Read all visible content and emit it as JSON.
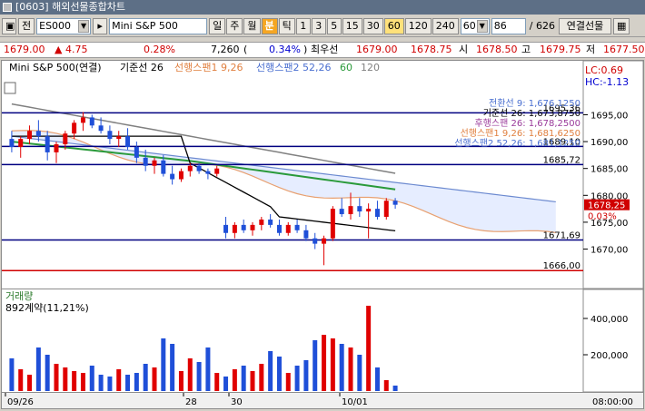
{
  "window": {
    "title": "[0603] 해외선물종합차트"
  },
  "toolbar": {
    "jeon_label": "전",
    "symbol": "ES000",
    "product_name": "Mini S&P 500",
    "period_buttons": [
      "일",
      "주",
      "월",
      "분",
      "틱",
      "1",
      "3",
      "5",
      "15",
      "30",
      "60",
      "120",
      "240"
    ],
    "active_period": "분",
    "selected_interval": "60",
    "interval_value": "60",
    "count_value": "86",
    "count_total": "/ 626",
    "link_button": "연결선물"
  },
  "quote": {
    "price": "1679.00",
    "change": "▲ 4.75",
    "change_pct": "0.28%",
    "volume": "7,260",
    "vol_open_paren": "(",
    "vol_pct": "0.34%",
    "vol_close_paren": ")",
    "best_label": "최우선",
    "bid": "1679.00",
    "ask": "1678.75",
    "open_label": "시",
    "open": "1678.50",
    "high_label": "고",
    "high": "1679.75",
    "low_label": "저",
    "low": "1677.50"
  },
  "chart": {
    "legend": {
      "title": "Mini S&P 500(연결)",
      "base_line": "기준선 26",
      "span1": "선행스팬1 9,26",
      "span2": "선행스팬2 52,26",
      "extra1": "60",
      "extra2": "120"
    },
    "corner": {
      "lc": "LC:0.69",
      "hc": "HC:-1.13"
    },
    "price_ticks": [
      "1695,00",
      "1690,00",
      "1685,00",
      "1680,00",
      "1675,00",
      "1670,00"
    ],
    "hlines": [
      {
        "label": "1695,36",
        "value": 1695.36,
        "color": "#000080"
      },
      {
        "label": "1689,10",
        "value": 1689.1,
        "color": "#000080"
      },
      {
        "label": "1685,72",
        "value": 1685.72,
        "color": "#000080"
      },
      {
        "label": "1671,69",
        "value": 1671.69,
        "color": "#000080"
      },
      {
        "label": "1666,00",
        "value": 1666.0,
        "color": "#d00000"
      }
    ],
    "overlay_labels": [
      {
        "text": "전환선 9: 1,676,1250",
        "color": "#4a6fd0"
      },
      {
        "text": "기준선 26: 1,673,8750",
        "color": "#000000"
      },
      {
        "text": "후행스팬 26: 1,678,2500",
        "color": "#9a3a9a"
      },
      {
        "text": "선행스팬1 9,26: 1,681,6250",
        "color": "#e08040"
      },
      {
        "text": "선행스팬2 52,26: 1,681,1250",
        "color": "#4a6fd0"
      }
    ],
    "current_price": "1678,25",
    "current_pct": "0,03%",
    "volume_title": "거래량",
    "volume_sub": "892계약(11,21%)",
    "volume_ticks": [
      "400,000",
      "200,000"
    ],
    "date_labels": [
      "09/26",
      "28",
      "30",
      "10/01"
    ],
    "time_label": "08:00:00"
  },
  "chart_data": {
    "type": "candlestick",
    "candles": [
      [
        1690.5,
        1692,
        1688,
        1689
      ],
      [
        1689,
        1691,
        1687,
        1690.5
      ],
      [
        1690.5,
        1693,
        1689.5,
        1692
      ],
      [
        1692,
        1694,
        1690,
        1691
      ],
      [
        1691,
        1692,
        1686.5,
        1688
      ],
      [
        1688,
        1690,
        1686,
        1689.5
      ],
      [
        1689.5,
        1692,
        1688.5,
        1691.5
      ],
      [
        1691.5,
        1694,
        1690.5,
        1693.5
      ],
      [
        1693.5,
        1695.5,
        1692,
        1694.5
      ],
      [
        1694.5,
        1695,
        1692.5,
        1693
      ],
      [
        1693,
        1694.5,
        1691.5,
        1692
      ],
      [
        1692,
        1693,
        1689.5,
        1690.5
      ],
      [
        1690.5,
        1692,
        1689,
        1691
      ],
      [
        1691,
        1692.5,
        1688.5,
        1689
      ],
      [
        1689,
        1690,
        1686,
        1687
      ],
      [
        1687,
        1688.5,
        1684.5,
        1685.5
      ],
      [
        1685.5,
        1687,
        1684,
        1686.5
      ],
      [
        1686.5,
        1687.5,
        1683.5,
        1684
      ],
      [
        1684,
        1685.5,
        1682,
        1683
      ],
      [
        1683,
        1685,
        1682.5,
        1684.5
      ],
      [
        1684.5,
        1686,
        1683.5,
        1685.5
      ],
      [
        1685.5,
        1686,
        1684,
        1684.5
      ],
      [
        1684.5,
        1685,
        1683,
        1684
      ],
      [
        1684,
        1685.5,
        1683.5,
        1685
      ],
      [
        1674.5,
        1676,
        1672,
        1673
      ],
      [
        1673,
        1675,
        1672,
        1674.5
      ],
      [
        1674.5,
        1675.5,
        1673,
        1673.5
      ],
      [
        1673.5,
        1675,
        1672.5,
        1674.5
      ],
      [
        1674.5,
        1676,
        1673.5,
        1675.5
      ],
      [
        1675.5,
        1676.5,
        1674,
        1674.5
      ],
      [
        1674.5,
        1675.5,
        1672.5,
        1673
      ],
      [
        1673,
        1675,
        1672.5,
        1674.5
      ],
      [
        1674.5,
        1675.5,
        1673,
        1673.5
      ],
      [
        1673.5,
        1674.5,
        1671.5,
        1672
      ],
      [
        1672,
        1673,
        1670,
        1671
      ],
      [
        1671,
        1672.5,
        1667,
        1672
      ],
      [
        1672,
        1678,
        1671.5,
        1677.5
      ],
      [
        1677.5,
        1679.5,
        1676,
        1676.5
      ],
      [
        1676.5,
        1680.5,
        1675.5,
        1678
      ],
      [
        1678,
        1679.5,
        1676,
        1677
      ],
      [
        1677,
        1678.5,
        1672,
        1677.5
      ],
      [
        1677.5,
        1679,
        1675.5,
        1676
      ],
      [
        1676,
        1679.5,
        1675.5,
        1679
      ],
      [
        1679,
        1679.5,
        1677.5,
        1678.25
      ]
    ],
    "volumes": [
      180000,
      120000,
      90000,
      240000,
      200000,
      150000,
      130000,
      110000,
      100000,
      140000,
      90000,
      80000,
      120000,
      90000,
      100000,
      150000,
      130000,
      290000,
      260000,
      110000,
      180000,
      160000,
      240000,
      100000,
      80000,
      120000,
      140000,
      110000,
      150000,
      220000,
      190000,
      100000,
      140000,
      170000,
      280000,
      310000,
      290000,
      260000,
      240000,
      200000,
      470000,
      130000,
      60000,
      30000
    ],
    "ylim": [
      1663,
      1702
    ]
  }
}
